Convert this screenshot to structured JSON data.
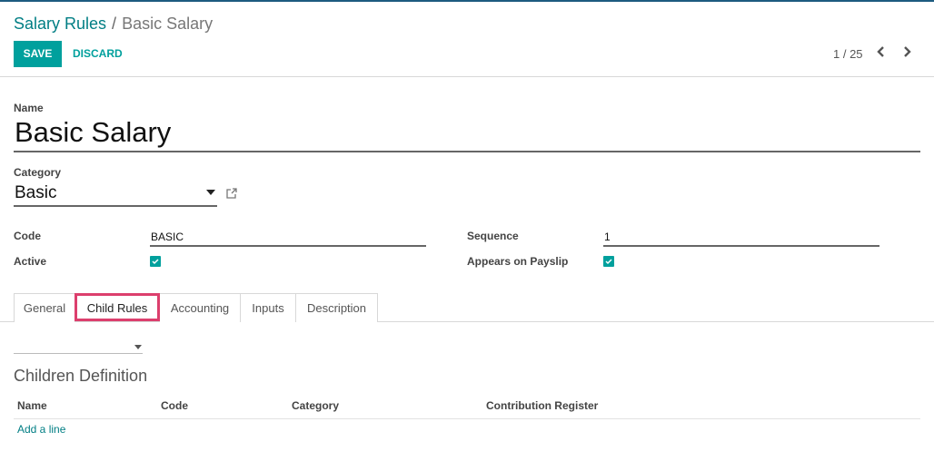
{
  "breadcrumb": {
    "parent": "Salary Rules",
    "separator": "/",
    "current": "Basic Salary"
  },
  "toolbar": {
    "save_label": "SAVE",
    "discard_label": "DISCARD"
  },
  "pager": {
    "value": "1 / 25",
    "prev_icon": "chevron-left-icon",
    "next_icon": "chevron-right-icon"
  },
  "form": {
    "name_label": "Name",
    "name_value": "Basic Salary",
    "category_label": "Category",
    "category_value": "Basic",
    "code_label": "Code",
    "code_value": "BASIC",
    "active_label": "Active",
    "active_checked": true,
    "sequence_label": "Sequence",
    "sequence_value": "1",
    "payslip_label": "Appears on Payslip",
    "payslip_checked": true
  },
  "tabs": [
    {
      "label": "General",
      "active": false
    },
    {
      "label": "Child Rules",
      "active": true
    },
    {
      "label": "Accounting",
      "active": false
    },
    {
      "label": "Inputs",
      "active": false
    },
    {
      "label": "Description",
      "active": false
    }
  ],
  "child_rules": {
    "parent_rule_value": "",
    "section_title": "Children Definition",
    "columns": [
      "Name",
      "Code",
      "Category",
      "Contribution Register"
    ],
    "rows": [],
    "add_line_label": "Add a line"
  },
  "colors": {
    "primary": "#00a09d",
    "link": "#017e84",
    "highlight": "#dc3f6d",
    "topbar": "#1d5b7f"
  }
}
